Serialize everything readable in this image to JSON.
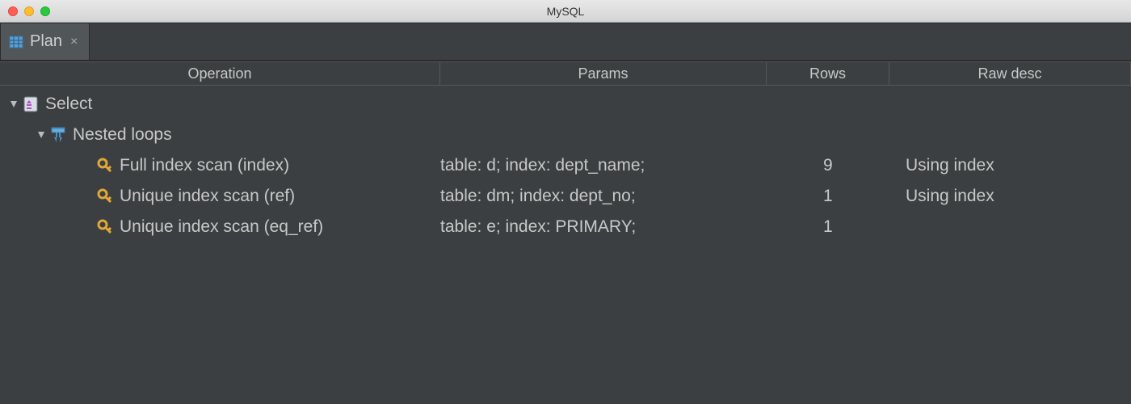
{
  "window": {
    "title": "MySQL"
  },
  "tab": {
    "label": "Plan",
    "close_char": "×"
  },
  "columns": {
    "operation": "Operation",
    "params": "Params",
    "rows": "Rows",
    "raw": "Raw desc"
  },
  "tree": {
    "root": {
      "label": "Select"
    },
    "nested": {
      "label": "Nested loops"
    },
    "leaves": [
      {
        "op": "Full index scan (index)",
        "params": "table: d; index: dept_name;",
        "rows": "9",
        "raw": "Using index"
      },
      {
        "op": "Unique index scan (ref)",
        "params": "table: dm; index: dept_no;",
        "rows": "1",
        "raw": "Using index"
      },
      {
        "op": "Unique index scan (eq_ref)",
        "params": "table: e; index: PRIMARY;",
        "rows": "1",
        "raw": ""
      }
    ]
  }
}
